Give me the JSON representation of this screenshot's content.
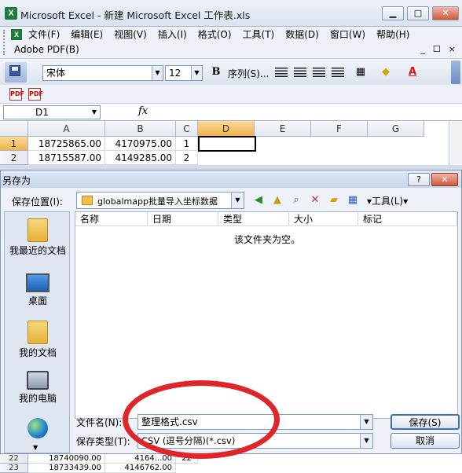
{
  "window": {
    "title": "Microsoft Excel - 新建 Microsoft Excel 工作表.xls",
    "logo_text": "X",
    "controls": [
      "▁",
      "□",
      "✕"
    ],
    "doc_controls": [
      "_",
      "☐",
      "×"
    ]
  },
  "menu": {
    "items": [
      "文件(F)",
      "编辑(E)",
      "视图(V)",
      "插入(I)",
      "格式(O)",
      "工具(T)",
      "数据(D)",
      "窗口(W)",
      "帮助(H)"
    ],
    "row2": "Adobe PDF(B)"
  },
  "toolbar": {
    "font": "宋体",
    "size": "12",
    "bold": "B",
    "sequence": "序列(S)..."
  },
  "formula_bar": {
    "name_box": "D1",
    "fx": "fx"
  },
  "sheet": {
    "columns": [
      "A",
      "B",
      "C",
      "D",
      "E",
      "F",
      "G"
    ],
    "rows": [
      {
        "num": "1",
        "a": "18725865.00",
        "b": "4170975.00",
        "c": "1"
      },
      {
        "num": "2",
        "a": "18715587.00",
        "b": "4149285.00",
        "c": "2"
      }
    ],
    "bottom_rows": [
      {
        "num": "22",
        "a": "18740090.00",
        "b": "4164...00",
        "c": "22"
      },
      {
        "num": "23",
        "a": "18733439.00",
        "b": "4146762.00",
        "c": ""
      }
    ]
  },
  "dialog": {
    "title": "另存为",
    "help": "?",
    "close": "✕",
    "save_in_label": "保存位置(I):",
    "save_in_value": "globalmapp批量导入坐标数据",
    "tools": "▾工具(L)▾",
    "places": [
      "我最近的文档",
      "桌面",
      "我的文档",
      "我的电脑"
    ],
    "columns": [
      "名称",
      "日期",
      "类型",
      "大小",
      "标记"
    ],
    "empty_message": "该文件夹为空。",
    "filename_label": "文件名(N):",
    "filename_value": "整理格式.csv",
    "filetype_label": "保存类型(T):",
    "filetype_value": "CSV (逗号分隔)(*.csv)",
    "save_button": "保存(S)",
    "cancel_button": "取消"
  },
  "colors": {
    "annotation_circle": "#e0242a",
    "selected_header": "#f2b24a"
  }
}
